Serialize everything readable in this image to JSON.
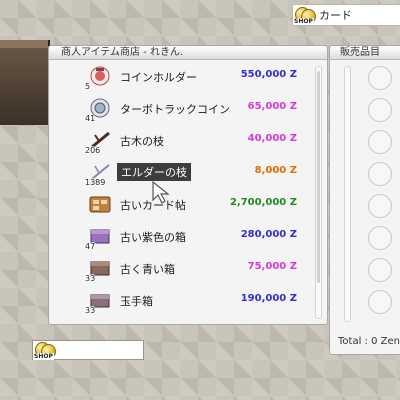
{
  "search_tag": {
    "shop_word": "SHOP",
    "label": "カード"
  },
  "bottom_tag": {
    "shop_word": "SHOP"
  },
  "shop_panel": {
    "title": "商人アイテム商店 - れきん.",
    "items": [
      {
        "name": "コインホルダー",
        "price": "550,000 Z",
        "qty": "5",
        "price_color": "#2f2fd0",
        "icon": "coin-holder-icon"
      },
      {
        "name": "ターボトラックコイン",
        "price": "65,000 Z",
        "qty": "41",
        "price_color": "#d63ad6",
        "icon": "turbo-track-coin-icon"
      },
      {
        "name": "古木の枝",
        "price": "40,000 Z",
        "qty": "206",
        "price_color": "#d63ad6",
        "icon": "old-branch-icon"
      },
      {
        "name": "エルダーの枝",
        "price": "8,000 Z",
        "qty": "1389",
        "price_color": "#e86a00",
        "icon": "elder-branch-icon"
      },
      {
        "name": "古いカード帖",
        "price": "2,700,000 Z",
        "qty": "",
        "price_color": "#1f8a1f",
        "icon": "old-card-album-icon"
      },
      {
        "name": "古い紫色の箱",
        "price": "280,000 Z",
        "qty": "47",
        "price_color": "#2f2fd0",
        "icon": "old-purple-box-icon"
      },
      {
        "name": "古く青い箱",
        "price": "75,000 Z",
        "qty": "33",
        "price_color": "#d63ad6",
        "icon": "old-blue-box-icon"
      },
      {
        "name": "玉手箱",
        "price": "190,000 Z",
        "qty": "33",
        "price_color": "#2f2fd0",
        "icon": "gift-box-icon"
      }
    ]
  },
  "sale_panel": {
    "title": "販売品目",
    "total": "Total : 0 Zeny"
  }
}
